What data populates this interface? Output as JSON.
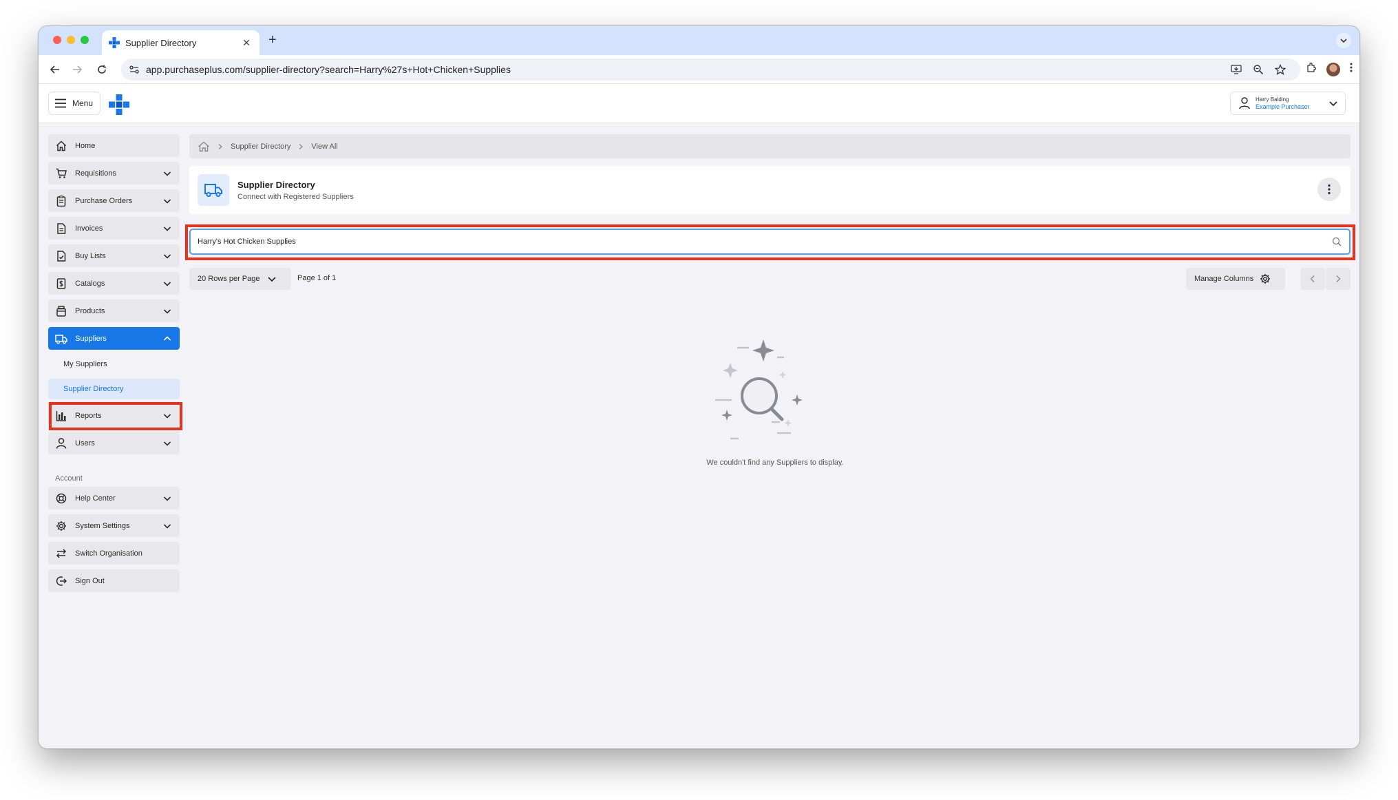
{
  "browser": {
    "tab_title": "Supplier Directory",
    "new_tab_symbol": "+",
    "close_symbol": "✕",
    "url": "app.purchaseplus.com/supplier-directory?search=Harry%27s+Hot+Chicken+Supplies"
  },
  "header": {
    "menu_label": "Menu",
    "user_name": "Harry Balding",
    "user_role": "Example Purchaser"
  },
  "sidebar": {
    "items": [
      {
        "label": "Home",
        "icon": "home-icon"
      },
      {
        "label": "Requisitions",
        "icon": "cart-icon"
      },
      {
        "label": "Purchase Orders",
        "icon": "clipboard-icon"
      },
      {
        "label": "Invoices",
        "icon": "document-icon"
      },
      {
        "label": "Buy Lists",
        "icon": "checklist-icon"
      },
      {
        "label": "Catalogs",
        "icon": "dollar-doc-icon"
      },
      {
        "label": "Products",
        "icon": "jar-icon"
      },
      {
        "label": "Suppliers",
        "icon": "truck-icon"
      },
      {
        "label": "Reports",
        "icon": "bar-chart-icon"
      },
      {
        "label": "Users",
        "icon": "user-icon"
      }
    ],
    "sub_items": [
      {
        "label": "My Suppliers"
      },
      {
        "label": "Supplier Directory"
      }
    ],
    "account_label": "Account",
    "account_items": [
      {
        "label": "Help Center",
        "icon": "lifebuoy-icon"
      },
      {
        "label": "System Settings",
        "icon": "gear-icon"
      },
      {
        "label": "Switch Organisation",
        "icon": "switch-icon"
      },
      {
        "label": "Sign Out",
        "icon": "sign-out-icon"
      }
    ]
  },
  "breadcrumb": {
    "items": [
      "Supplier Directory",
      "View All"
    ]
  },
  "page": {
    "title": "Supplier Directory",
    "subtitle": "Connect with Registered Suppliers"
  },
  "search": {
    "value": "Harry's Hot Chicken Supplies"
  },
  "table_controls": {
    "rows_per_page": "20 Rows per Page",
    "page_info": "Page 1 of 1",
    "manage_columns": "Manage Columns"
  },
  "empty_state": {
    "message": "We couldn't find any Suppliers to display."
  },
  "colors": {
    "accent": "#1777e6",
    "highlight": "#e8331c",
    "background": "#f3f3f7"
  }
}
